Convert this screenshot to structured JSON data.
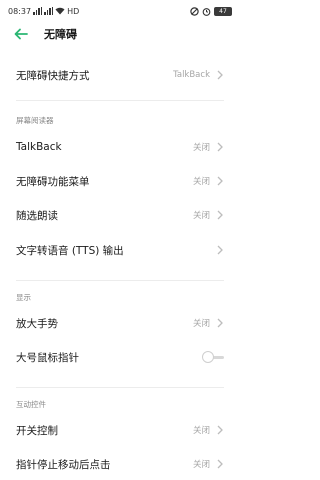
{
  "status_bar": {
    "time": "08:37",
    "network": "HD",
    "battery": "47"
  },
  "header": {
    "title": "无障碍"
  },
  "items": {
    "shortcut": {
      "label": "无障碍快捷方式",
      "value": "TalkBack"
    },
    "talkback": {
      "label": "TalkBack",
      "value": "关闭"
    },
    "menu": {
      "label": "无障碍功能菜单",
      "value": "关闭"
    },
    "select_to_speak": {
      "label": "随选朗读",
      "value": "关闭"
    },
    "tts": {
      "label": "文字转语音 (TTS) 输出"
    },
    "magnification": {
      "label": "放大手势",
      "value": "关闭"
    },
    "large_pointer": {
      "label": "大号鼠标指针",
      "enabled": false
    },
    "switch_access": {
      "label": "开关控制",
      "value": "关闭"
    },
    "autoclick": {
      "label": "指针停止移动后点击",
      "value": "关闭"
    }
  },
  "sections": {
    "screen_reader": "屏幕阅读器",
    "display": "显示",
    "interaction": "互动控件"
  },
  "colors": {
    "accent": "#2bb673",
    "value_text": "#a6a6a6",
    "section_text": "#888888"
  }
}
